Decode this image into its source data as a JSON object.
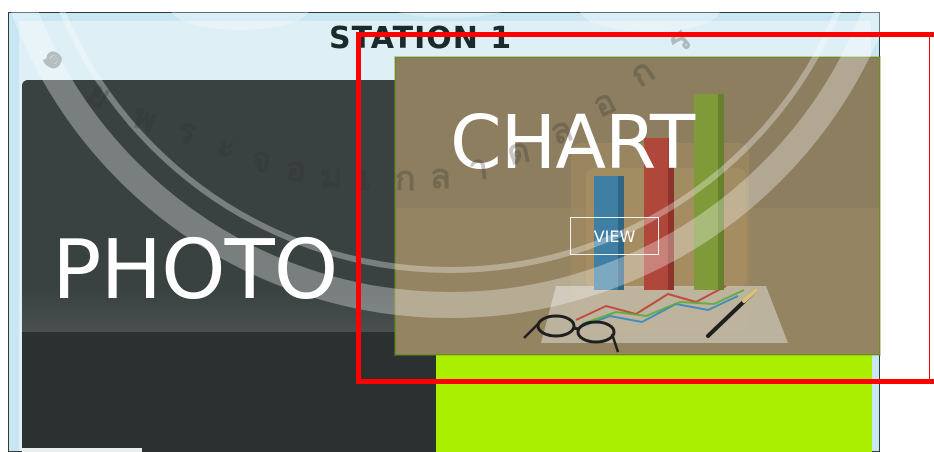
{
  "station": {
    "title": "STATION 1"
  },
  "tiles": {
    "photo": {
      "label": "PHOTO"
    },
    "chart": {
      "label": "CHART",
      "view_label": "VIEW"
    }
  },
  "colors": {
    "frame_background": "#c9e7f3",
    "photo_tile": "#3a4141",
    "photo_tile_lower": "#2b3030",
    "chart_overlay": "#8a7b5e",
    "green_tile": "#aaee00",
    "highlight": "#ff0000"
  },
  "icons": {
    "watermark": "seal-watermark-icon",
    "chart_illustration": "bar-chart-illustration-icon"
  }
}
